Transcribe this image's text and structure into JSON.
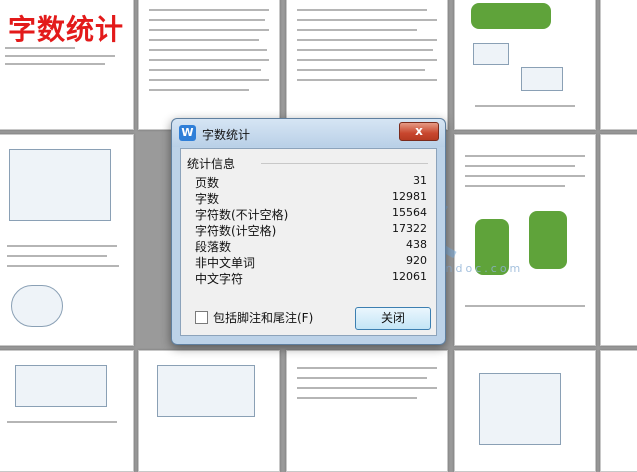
{
  "banner": {
    "text": "字数统计"
  },
  "dialog": {
    "title": "字数统计",
    "app_icon_letter": "W",
    "close_glyph": "x",
    "group_label": "统计信息",
    "stats": [
      {
        "label": "页数",
        "value": "31"
      },
      {
        "label": "字数",
        "value": "12981"
      },
      {
        "label": "字符数(不计空格)",
        "value": "15564"
      },
      {
        "label": "字符数(计空格)",
        "value": "17322"
      },
      {
        "label": "段落数",
        "value": "438"
      },
      {
        "label": "非中文单词",
        "value": "920"
      },
      {
        "label": "中文字符",
        "value": "12061"
      }
    ],
    "checkbox_label": "包括脚注和尾注(F)",
    "checkbox_checked": false,
    "close_button_label": "关闭"
  },
  "watermark": {
    "text": "www.renrendoc.com"
  },
  "colors": {
    "banner_red": "#e31a1a",
    "dialog_frame": "#bcd2e8",
    "close_red": "#c8472e",
    "button_blue": "#3c7fb1"
  },
  "icons": [
    "wps-writer-icon",
    "close-icon",
    "renrendoc-watermark-icon"
  ]
}
